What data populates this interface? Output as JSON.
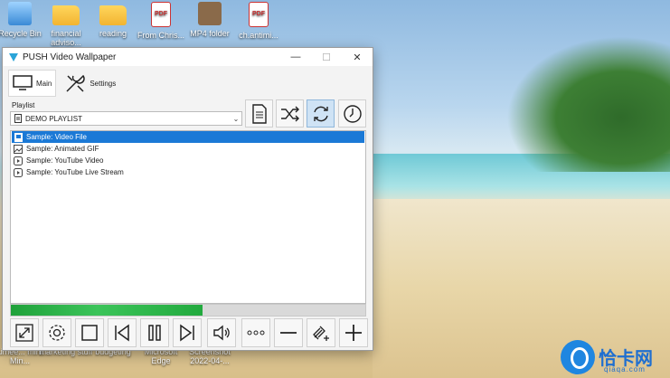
{
  "desktop": {
    "icons": [
      {
        "label": "Recycle Bin",
        "kind": "recycle"
      },
      {
        "label": "financial adviso...",
        "kind": "doc"
      },
      {
        "label": "reading",
        "kind": "folder"
      },
      {
        "label": "From Chris... ",
        "kind": "pdf"
      },
      {
        "label": "MP4 folder",
        "kind": "mp4"
      },
      {
        "label": "ch.antimi...",
        "kind": "pdf"
      }
    ],
    "bottom_icons": [
      {
        "label": "Aimee... mini: Min..."
      },
      {
        "label": "marketing stuff"
      },
      {
        "label": "budgeting"
      },
      {
        "label": "Microsoft Edge"
      },
      {
        "label": "Screenshot 2022-04-..."
      }
    ]
  },
  "window": {
    "title": "PUSH Video Wallpaper",
    "controls": {
      "minimize": "—",
      "maximize": "☐",
      "close": "✕"
    },
    "tabs": [
      {
        "label": "Main",
        "icon": "monitor-icon",
        "active": true
      },
      {
        "label": "Settings",
        "icon": "tools-icon",
        "active": false
      }
    ],
    "playlist": {
      "label": "Playlist",
      "selected": "DEMO PLAYLIST"
    },
    "toolbar": [
      "new-playlist-icon",
      "shuffle-icon",
      "loop-icon",
      "timer-icon"
    ],
    "items": [
      {
        "label": "Sample: Video File",
        "icon": "video-file-icon",
        "selected": true
      },
      {
        "label": "Sample: Animated GIF",
        "icon": "image-icon",
        "selected": false
      },
      {
        "label": "Sample: YouTube Video",
        "icon": "play-icon",
        "selected": false
      },
      {
        "label": "Sample: YouTube Live Stream",
        "icon": "play-icon",
        "selected": false
      }
    ],
    "progress": 0.54,
    "bottom_buttons": [
      "fullscreen-icon",
      "settings-icon",
      "stop-icon",
      "previous-icon",
      "pause-icon",
      "next-icon",
      "volume-icon",
      "more-icon",
      "remove-icon",
      "add-url-icon",
      "add-icon"
    ]
  },
  "watermark": {
    "text": "恰卡网",
    "sub": "qiaqa.com"
  },
  "colors": {
    "accent": "#1b79d6",
    "progress": "#22aa3e"
  }
}
